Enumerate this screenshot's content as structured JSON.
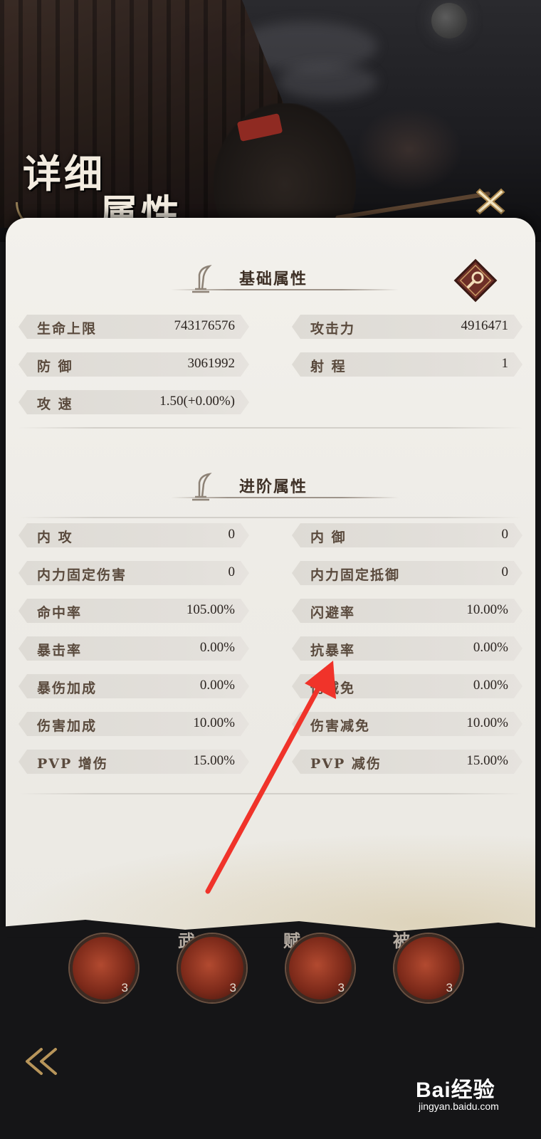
{
  "header": {
    "title_line1": "详细",
    "title_line2": "属性",
    "close_icon": "close-x-icon"
  },
  "basic_section": {
    "title": "基础属性",
    "search_icon": "magnifier-icon",
    "stats": [
      {
        "name": "生命上限",
        "value": "743176576"
      },
      {
        "name": "攻击力",
        "value": "4916471"
      },
      {
        "name": "防 御",
        "value": "3061992"
      },
      {
        "name": "射 程",
        "value": "1"
      },
      {
        "name": "攻 速",
        "value": "1.50(+0.00%)"
      }
    ]
  },
  "advanced_section": {
    "title": "进阶属性",
    "stats": [
      {
        "name": "内 攻",
        "value": "0"
      },
      {
        "name": "内 御",
        "value": "0"
      },
      {
        "name": "内力固定伤害",
        "value": "0"
      },
      {
        "name": "内力固定抵御",
        "value": "0"
      },
      {
        "name": "命中率",
        "value": "105.00%"
      },
      {
        "name": "闪避率",
        "value": "10.00%"
      },
      {
        "name": "暴击率",
        "value": "0.00%"
      },
      {
        "name": "抗暴率",
        "value": "0.00%"
      },
      {
        "name": "暴伤加成",
        "value": "0.00%"
      },
      {
        "name": "伤减免",
        "value": "0.00%"
      },
      {
        "name": "伤害加成",
        "value": "10.00%"
      },
      {
        "name": "伤害减免",
        "value": "10.00%"
      },
      {
        "name": "PVP 增伤",
        "value": "15.00%"
      },
      {
        "name": "PVP 减伤",
        "value": "15.00%"
      }
    ]
  },
  "skill_bar": {
    "tags": [
      "武",
      "赋",
      "被"
    ],
    "skills": [
      {
        "level": "3"
      },
      {
        "level": "3"
      },
      {
        "level": "3"
      },
      {
        "level": "3"
      }
    ]
  },
  "watermark": {
    "brand": "Bai经验",
    "url": "jingyan.baidu.com"
  },
  "colors": {
    "panel_bg": "#f0eeea",
    "annotation_arrow": "#f0332a",
    "accent_gold": "#c4a56e"
  }
}
